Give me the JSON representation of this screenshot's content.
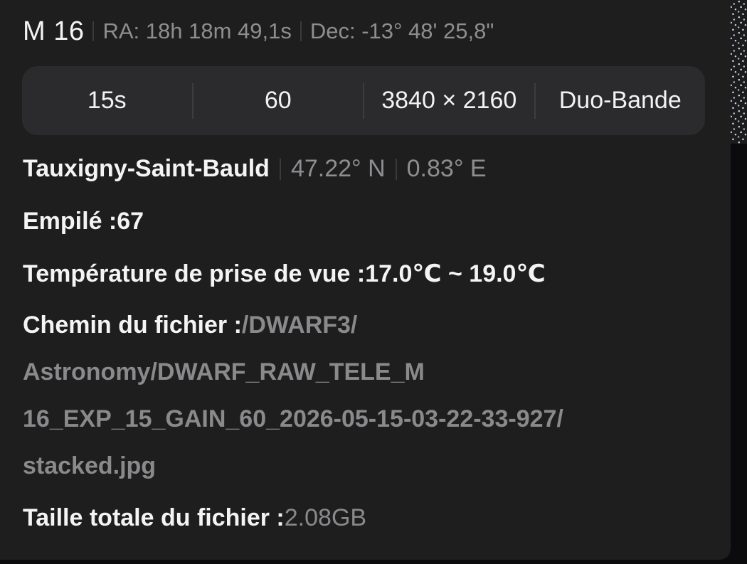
{
  "header": {
    "object_name": "M 16",
    "ra": "RA: 18h 18m 49,1s",
    "dec": "Dec: -13° 48' 25,8\""
  },
  "settings": {
    "exposure": "15s",
    "gain": "60",
    "resolution": "3840 × 2160",
    "filter": "Duo-Bande"
  },
  "location": {
    "name": "Tauxigny-Saint-Bauld",
    "latitude": "47.22° N",
    "longitude": "0.83° E"
  },
  "stacked": {
    "label": "Empilé :",
    "value": "67"
  },
  "temperature": {
    "label": "Température de prise de vue :",
    "value": "17.0℃ ~ 19.0℃"
  },
  "file_path": {
    "label": "Chemin du fichier :",
    "lines": [
      "/DWARF3/",
      "Astronomy/DWARF_RAW_TELE_M",
      "16_EXP_15_GAIN_60_2026-05-15-03-22-33-927/",
      "stacked.jpg"
    ]
  },
  "file_size": {
    "label": "Taille totale du fichier :",
    "value": "2.08GB"
  }
}
